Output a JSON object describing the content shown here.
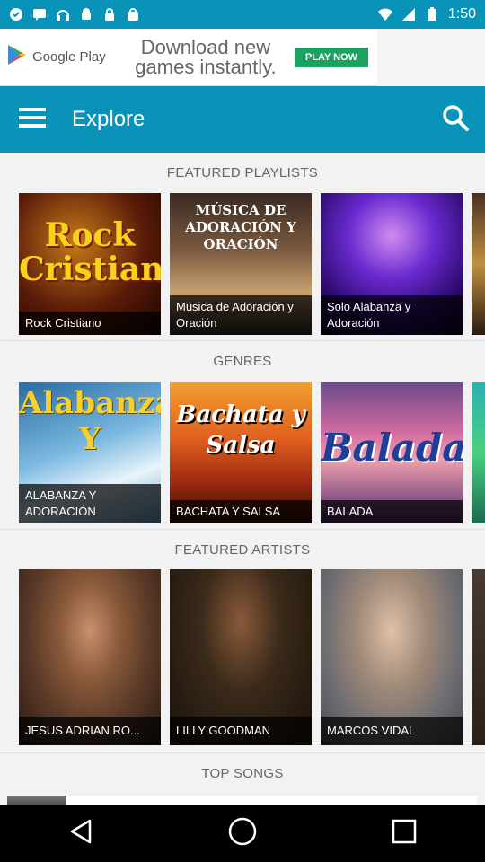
{
  "status": {
    "time": "1:50"
  },
  "ad": {
    "brand": "Google Play",
    "text": "Download new games instantly.",
    "cta": "PLAY NOW"
  },
  "appbar": {
    "title": "Explore"
  },
  "sections": {
    "playlists": "FEATURED PLAYLISTS",
    "genres": "GENRES",
    "artists": "FEATURED ARTISTS",
    "top_songs": "TOP SONGS"
  },
  "playlists": [
    {
      "label": "Rock Cristiano",
      "cover": "Rock Cristiano"
    },
    {
      "label": "Música de Adoración y Oración",
      "cover": "MÚSICA DE ADORACIÓN Y ORACIÓN"
    },
    {
      "label": "Solo Alabanza y Adoración"
    }
  ],
  "genres": [
    {
      "label": "ALABANZA Y ADORACIÓN",
      "cover": "Alabanza Y"
    },
    {
      "label": "BACHATA Y SALSA",
      "cover": "Bachata y Salsa"
    },
    {
      "label": "BALADA",
      "cover": "Balada"
    }
  ],
  "artists": [
    {
      "label": "JESUS ADRIAN RO..."
    },
    {
      "label": "LILLY GOODMAN"
    },
    {
      "label": "MARCOS VIDAL"
    }
  ],
  "colors": {
    "primary": "#0a93b9",
    "ad_cta": "#1aa260"
  }
}
